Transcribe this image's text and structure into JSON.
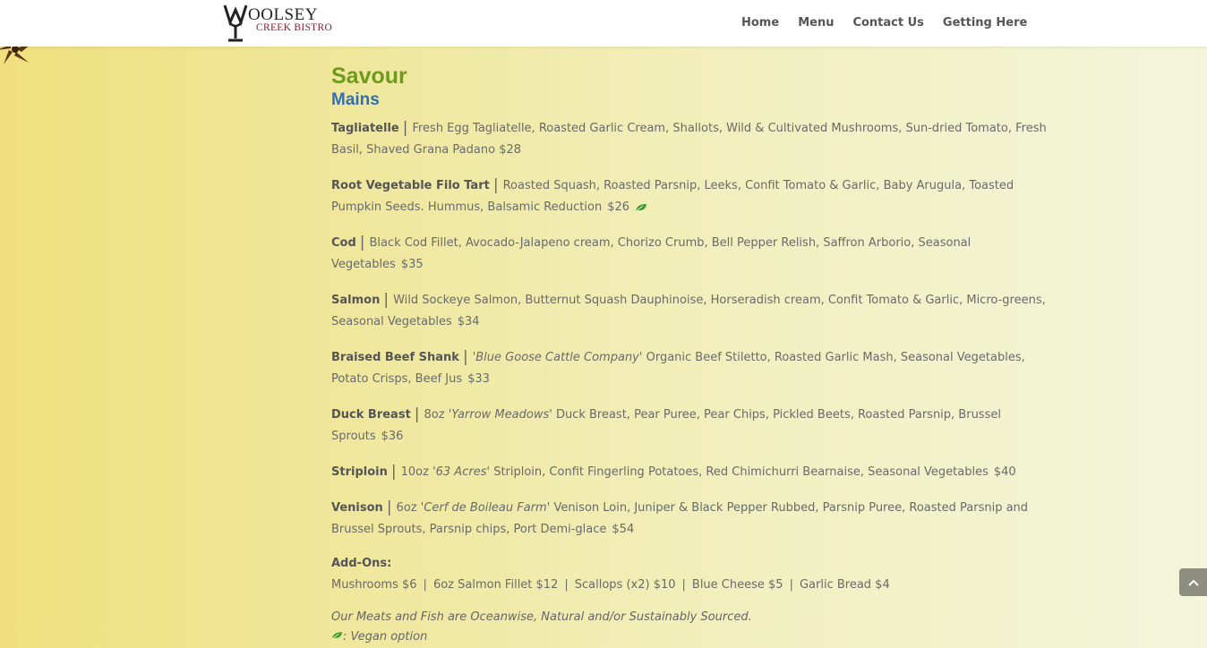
{
  "logo": {
    "top_text": "OOLSEY",
    "bottom_text": "CREEK BISTRO"
  },
  "nav": [
    "Home",
    "Menu",
    "Contact Us",
    "Getting Here"
  ],
  "section_title": "Savour",
  "section_subtitle": "Mains",
  "items": [
    {
      "name": "Tagliatelle",
      "description": "Fresh Egg Tagliatelle, Roasted Garlic Cream, Shallots, Wild & Cultivated Mushrooms, Sun-dried Tomato, Fresh Basil, Shaved Grana Padano",
      "price": "$28"
    },
    {
      "name": "Root Vegetable Filo Tart",
      "description": "Roasted Squash, Roasted Parsnip, Leeks, Confit Tomato & Garlic, Baby Arugula, Toasted Pumpkin Seeds. Hummus, Balsamic Reduction",
      "price": "$26"
    },
    {
      "name": "Cod",
      "description": "Black Cod Fillet, Avocado-Jalapeno cream, Chorizo Crumb, Bell Pepper Relish, Saffron Arborio, Seasonal Vegetables",
      "price": "$35"
    },
    {
      "name": "Salmon",
      "description": "Wild Sockeye Salmon, Butternut Squash Dauphinoise, Horseradish cream, Confit Tomato & Garlic, Micro-greens, Seasonal Vegetables",
      "price": "$34"
    },
    {
      "name": "Braised Beef Shank",
      "italic": "'Blue Goose Cattle Company'",
      "description": "Organic Beef Stiletto, Roasted Garlic Mash, Seasonal Vegetables, Potato Crisps, Beef Jus",
      "price": "$33"
    },
    {
      "name": "Duck Breast",
      "prefix": "8oz",
      "italic": "'Yarrow Meadows'",
      "description": "Duck Breast, Pear Puree, Pear Chips, Pickled Beets, Roasted Parsnip, Brussel Sprouts",
      "price": "$36"
    },
    {
      "name": "Striploin",
      "prefix": "10oz",
      "italic": "'63 Acres'",
      "description": "Striploin, Confit Fingerling Potatoes, Red Chimichurri Bearnaise, Seasonal Vegetables",
      "price": "$40"
    },
    {
      "name": "Venison",
      "prefix": "6oz",
      "italic": "'Cerf de Boileau Farm'",
      "description": "Venison Loin, Juniper & Black Pepper Rubbed, Parsnip Puree, Roasted Parsnip and Brussel Sprouts, Parsnip chips, Port Demi-glace",
      "price": "$54"
    }
  ],
  "addons": {
    "title": "Add-Ons:",
    "list": [
      "Mushrooms $6",
      "6oz Salmon Fillet $12",
      "Scallops (x2) $10",
      "Blue Cheese $5",
      "Garlic Bread $4"
    ]
  },
  "notes": {
    "sourcing": "Our Meats and Fish are Oceanwise, Natural and/or Sustainably Sourced.",
    "vegan": ": Vegan option"
  },
  "colors": {
    "title_green": "#6e9a1e",
    "subtitle_blue": "#2f6fb2",
    "leaf_green": "#3a9a2a",
    "logo_red": "#8a1c2e"
  },
  "icons": {
    "vegan": "leaf-icon",
    "back_to_top": "chevron-up-icon",
    "decor": "star-anise-icon"
  }
}
